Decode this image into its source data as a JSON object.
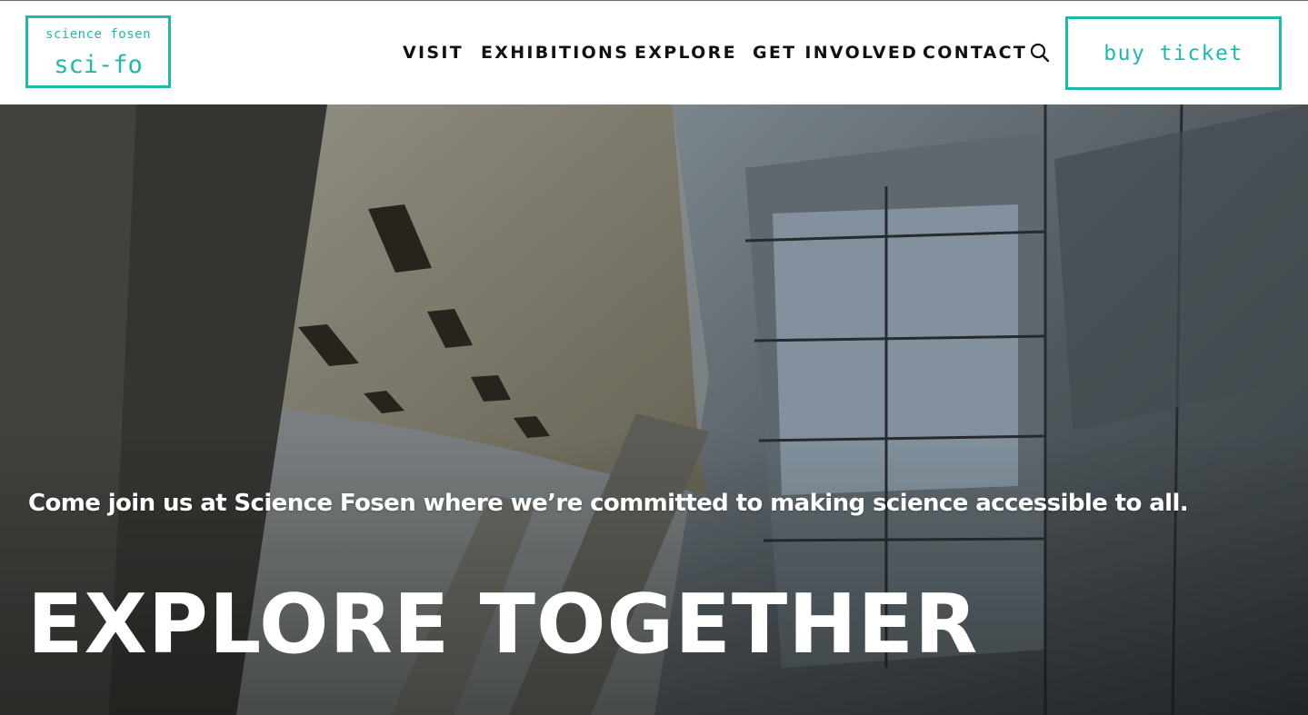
{
  "brand": {
    "small": "science fosen",
    "large": "sci-fo",
    "accent_color": "#1fb8aa"
  },
  "nav": {
    "items": [
      {
        "label": "VISIT"
      },
      {
        "label": "EXHIBITIONS"
      },
      {
        "label": "EXPLORE"
      },
      {
        "label": "GET INVOLVED"
      },
      {
        "label": "CONTACT"
      }
    ],
    "search_icon": "search-icon",
    "ticket_label": "buy ticket"
  },
  "hero": {
    "tagline": "Come join us at Science Fosen where we’re committed to making science accessible to all.",
    "headline": "EXPLORE TOGETHER",
    "image": "modern glass and steel museum architecture"
  }
}
